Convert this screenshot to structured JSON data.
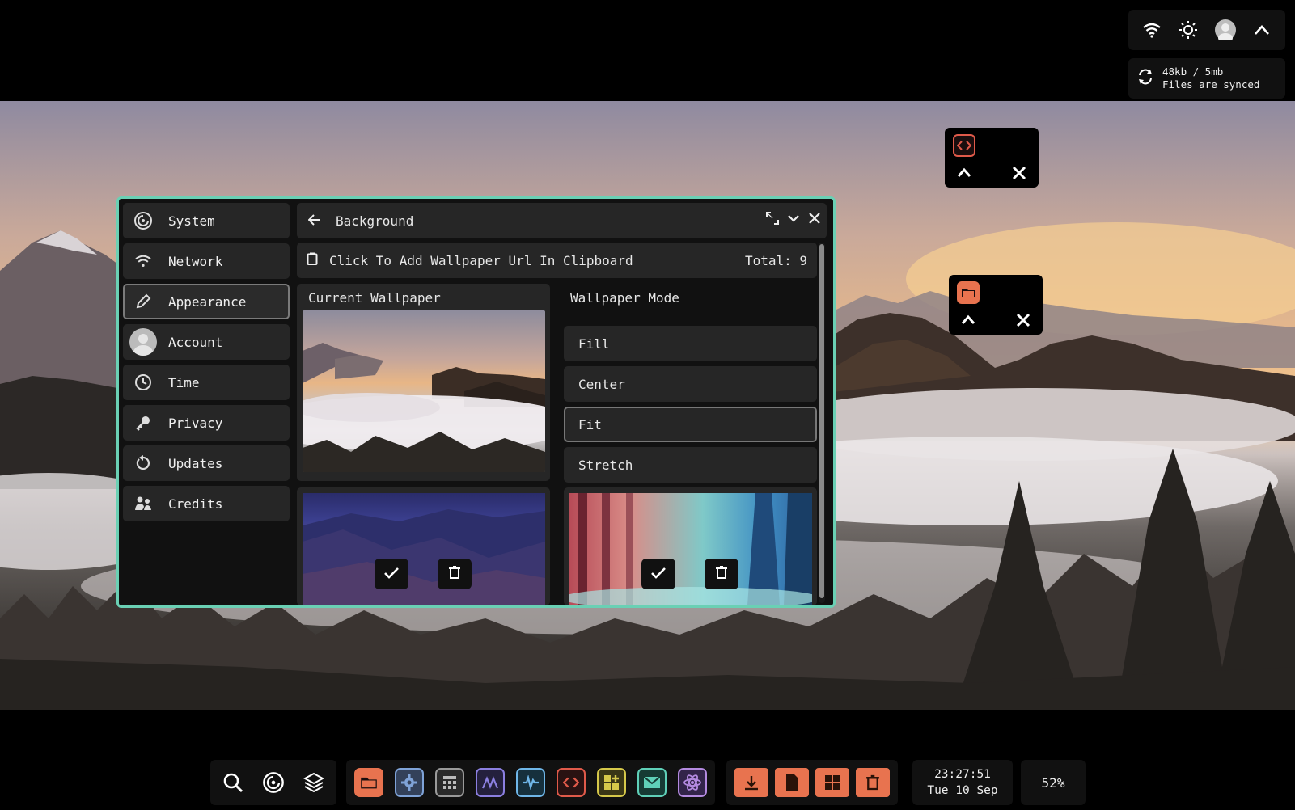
{
  "tray": {
    "icons": [
      "wifi-icon",
      "brightness-icon",
      "avatar",
      "chevron-up-icon"
    ],
    "sync_size": "48kb / 5mb",
    "sync_status": "Files are synced"
  },
  "mini_windows": [
    {
      "app": "code-editor",
      "accent": "#e05a4a"
    },
    {
      "app": "file-manager",
      "accent": "#e8734f"
    }
  ],
  "settings": {
    "sidebar": {
      "items": [
        {
          "label": "System",
          "icon": "system-icon"
        },
        {
          "label": "Network",
          "icon": "wifi-icon"
        },
        {
          "label": "Appearance",
          "icon": "pencil-icon",
          "active": true
        },
        {
          "label": "Account",
          "icon": "avatar"
        },
        {
          "label": "Time",
          "icon": "clock-icon"
        },
        {
          "label": "Privacy",
          "icon": "key-icon"
        },
        {
          "label": "Updates",
          "icon": "refresh-icon"
        },
        {
          "label": "Credits",
          "icon": "people-icon"
        }
      ]
    },
    "header": {
      "title": "Background"
    },
    "clipboard_label": "Click To Add Wallpaper Url In Clipboard",
    "total": "Total: 9",
    "current_wallpaper_label": "Current Wallpaper",
    "wallpaper_mode_label": "Wallpaper Mode",
    "modes": [
      "Fill",
      "Center",
      "Fit",
      "Stretch"
    ],
    "active_mode": "Fit",
    "border_color": "#6ad0b4"
  },
  "taskbar": {
    "time": "23:27:51",
    "date": "Tue 10 Sep",
    "battery": "52%",
    "apps": [
      {
        "name": "files-app-icon",
        "color": "#e8734f"
      },
      {
        "name": "settings-app-icon",
        "color": "#7fa3d8"
      },
      {
        "name": "calculator-app-icon",
        "color": "#9a9a9a"
      },
      {
        "name": "charts-app-icon",
        "color": "#8b7fe0"
      },
      {
        "name": "monitor-app-icon",
        "color": "#6fb6e8"
      },
      {
        "name": "code-app-icon",
        "color": "#e05a4a"
      },
      {
        "name": "widgets-app-icon",
        "color": "#d6c84a"
      },
      {
        "name": "mail-app-icon",
        "color": "#5fd0b8"
      },
      {
        "name": "atom-app-icon",
        "color": "#b48ae0"
      }
    ],
    "folders": [
      "downloads-folder-icon",
      "documents-folder-icon",
      "apps-folder-icon",
      "trash-folder-icon"
    ]
  }
}
